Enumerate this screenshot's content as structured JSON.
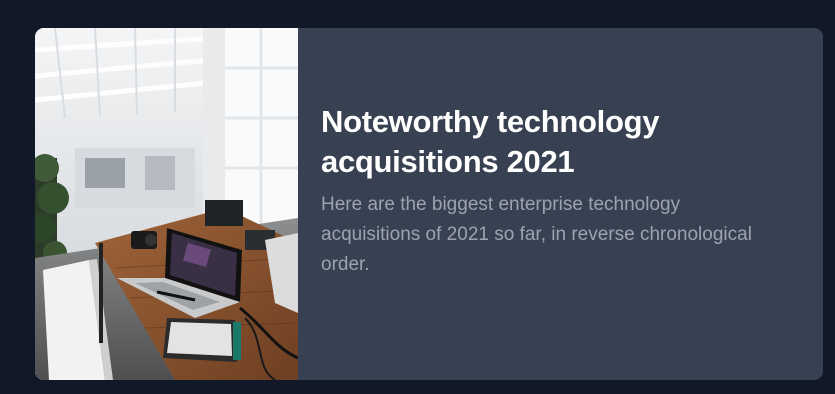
{
  "card": {
    "image_alt": "Office workspace with laptops on a wooden desk",
    "title": "Noteworthy technology acquisitions 2021",
    "description": "Here are the biggest enterprise technology acquisitions of 2021 so far, in reverse chronological order."
  },
  "colors": {
    "page_background": "#111827",
    "card_background": "#374151",
    "title_text": "#ffffff",
    "description_text": "#9ca3af"
  }
}
